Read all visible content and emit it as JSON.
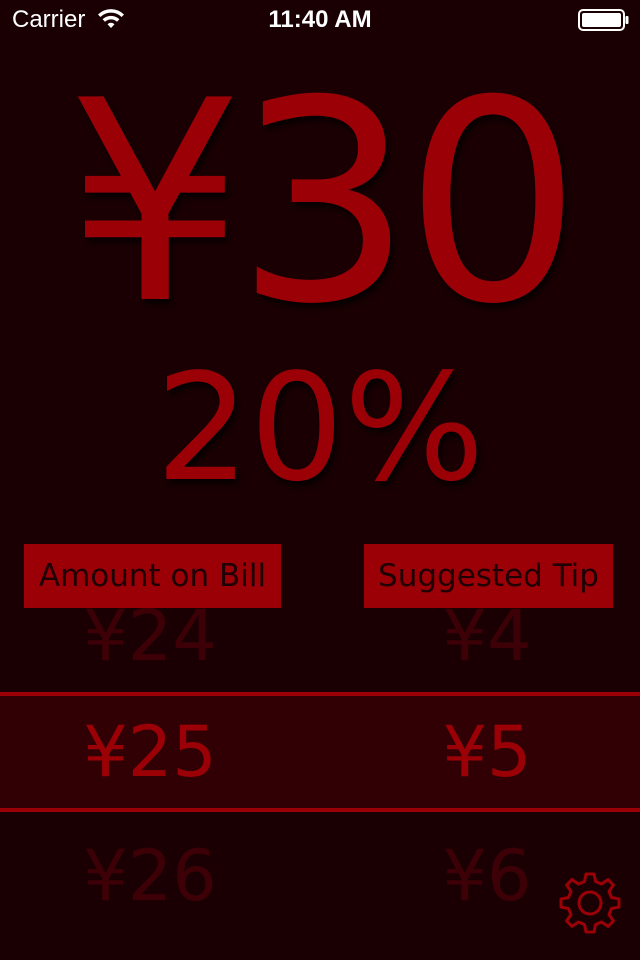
{
  "status_bar": {
    "carrier": "Carrier",
    "time": "11:40 AM"
  },
  "display": {
    "total": "¥30",
    "tip_percent": "20%"
  },
  "headers": {
    "bill": "Amount on Bill",
    "tip": "Suggested Tip"
  },
  "picker": {
    "rows": [
      {
        "bill": "¥24",
        "tip": "¥4"
      },
      {
        "bill": "¥25",
        "tip": "¥5"
      },
      {
        "bill": "¥26",
        "tip": "¥6"
      }
    ],
    "selected_index": 1
  },
  "icons": {
    "wifi": "wifi-icon",
    "battery": "battery-icon",
    "settings": "gear-icon"
  },
  "colors": {
    "background": "#1a0003",
    "accent": "#9a0006",
    "selection": "#300004",
    "faded": "#3d0007"
  }
}
